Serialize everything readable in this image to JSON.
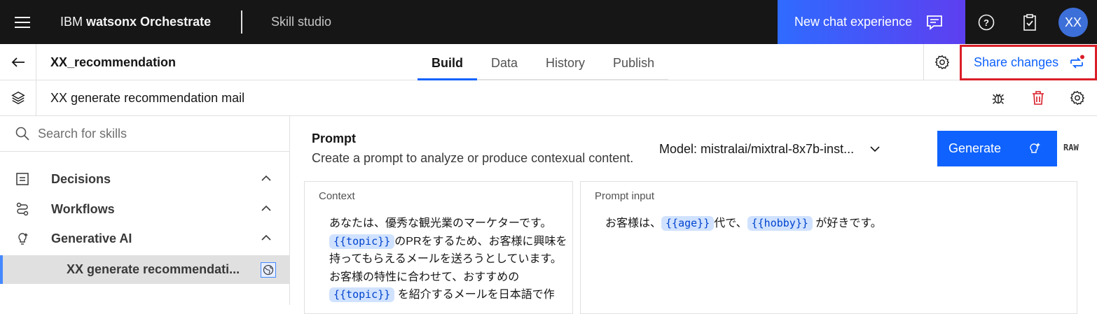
{
  "topbar": {
    "brand_prefix": "IBM",
    "brand_name": "watsonx Orchestrate",
    "app_name": "Skill studio",
    "new_chat_label": "New chat experience",
    "avatar_initials": "XX"
  },
  "header": {
    "project_title": "XX_recommendation",
    "tabs": [
      {
        "label": "Build",
        "active": true
      },
      {
        "label": "Data",
        "active": false
      },
      {
        "label": "History",
        "active": false
      },
      {
        "label": "Publish",
        "active": false
      }
    ],
    "share_label": "Share changes"
  },
  "skill_bar": {
    "title": "XX generate recommendation mail"
  },
  "sidebar": {
    "search_placeholder": "Search for skills",
    "categories": [
      {
        "label": "Decisions",
        "icon": "decision-icon"
      },
      {
        "label": "Workflows",
        "icon": "workflow-icon"
      },
      {
        "label": "Generative AI",
        "icon": "ai-bulb-icon"
      }
    ],
    "selected_item": "XX generate recommendati..."
  },
  "main": {
    "prompt_title": "Prompt",
    "prompt_desc": "Create a prompt to analyze or produce contexual content.",
    "model_label": "Model: mistralai/mixtral-8x7b-inst...",
    "generate_label": "Generate",
    "raw_label": "RAW",
    "context_label": "Context",
    "context": {
      "line1": "あなたは、優秀な観光業のマーケターです。",
      "var_topic": "{{topic}}",
      "line2_rest": "のPRをするため、お客様に興味を",
      "line3": "持ってもらえるメールを送ろうとしています。",
      "line4": "お客様の特性に合わせて、おすすめの",
      "line5_rest": "を紹介するメールを日本語で作"
    },
    "prompt_input_label": "Prompt input",
    "prompt_input": {
      "prefix": "お客様は、",
      "var_age": "{{age}}",
      "mid": "代で、",
      "var_hobby": "{{hobby}}",
      "suffix": "が好きです。"
    }
  },
  "colors": {
    "accent": "#0f62fe",
    "highlight_border": "#da1e28",
    "topbar": "#161616"
  }
}
